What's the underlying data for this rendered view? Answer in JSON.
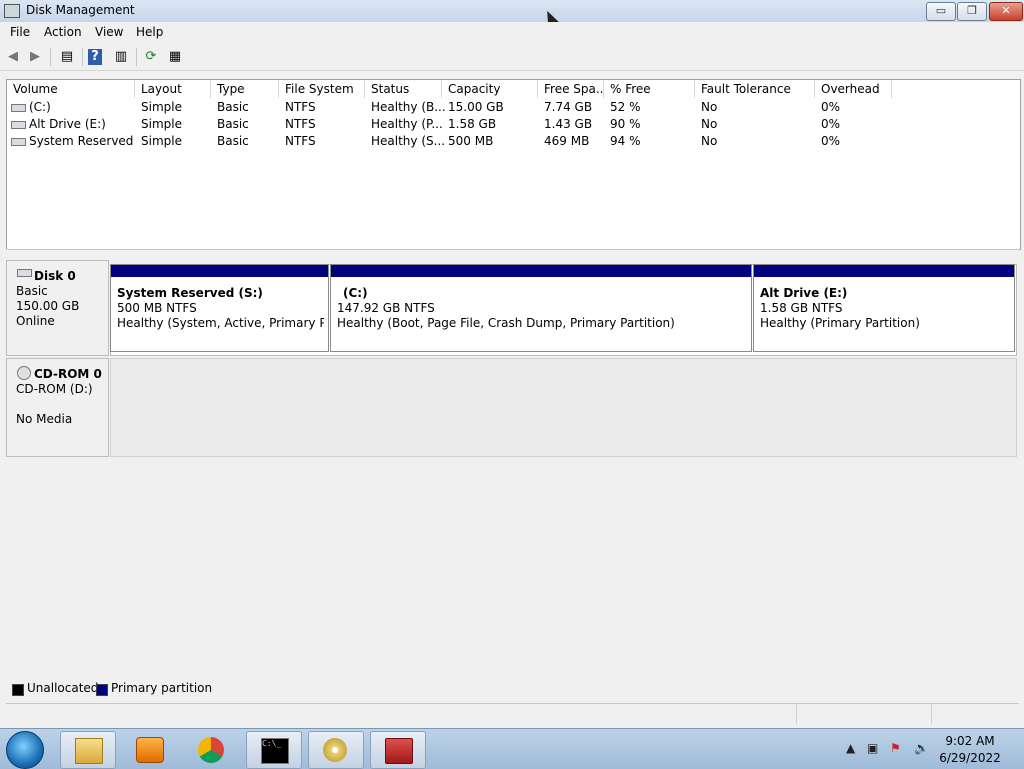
{
  "window": {
    "title": "Disk Management",
    "buttons": {
      "minimize": "▭",
      "maximize": "❐",
      "close": "✕"
    }
  },
  "menu": [
    "File",
    "Action",
    "View",
    "Help"
  ],
  "toolbar": {
    "icons": [
      "back-arrow-icon",
      "forward-arrow-icon",
      "show-hide-tree-icon",
      "help-icon",
      "properties-icon",
      "refresh-icon",
      "settings-list-icon"
    ]
  },
  "volume_table": {
    "columns": [
      "Volume",
      "Layout",
      "Type",
      "File System",
      "Status",
      "Capacity",
      "Free Spa...",
      "% Free",
      "Fault Tolerance",
      "Overhead"
    ],
    "rows": [
      [
        "(C:)",
        "Simple",
        "Basic",
        "NTFS",
        "Healthy (B...",
        "15.00 GB",
        "7.74 GB",
        "52 %",
        "No",
        "0%"
      ],
      [
        "Alt Drive (E:)",
        "Simple",
        "Basic",
        "NTFS",
        "Healthy (P...",
        "1.58 GB",
        "1.43 GB",
        "90 %",
        "No",
        "0%"
      ],
      [
        "System Reserved (...",
        "Simple",
        "Basic",
        "NTFS",
        "Healthy (S...",
        "500 MB",
        "469 MB",
        "94 %",
        "No",
        "0%"
      ]
    ]
  },
  "disks": [
    {
      "name": "Disk 0",
      "type": "Basic",
      "size": "150.00 GB",
      "state": "Online",
      "partitions": [
        {
          "title": "System Reserved  (S:)",
          "size": "500 MB NTFS",
          "status": "Healthy (System, Active, Primary Partit"
        },
        {
          "title": "(C:)",
          "size": "147.92 GB NTFS",
          "status": "Healthy (Boot, Page File, Crash Dump, Primary Partition)"
        },
        {
          "title": "Alt Drive  (E:)",
          "size": "1.58 GB NTFS",
          "status": "Healthy (Primary Partition)"
        }
      ]
    },
    {
      "name": "CD-ROM 0",
      "type": "CD-ROM (D:)",
      "state": "No Media"
    }
  ],
  "legend": [
    {
      "label": "Unallocated",
      "color": "#000000"
    },
    {
      "label": "Primary partition",
      "color": "#000080"
    }
  ],
  "taskbar": {
    "apps": [
      "explorer-icon",
      "media-player-icon",
      "chrome-icon",
      "cmd-icon",
      "disc-icon",
      "toolbox-icon"
    ],
    "time": "9:02 AM",
    "date": "6/29/2022"
  }
}
